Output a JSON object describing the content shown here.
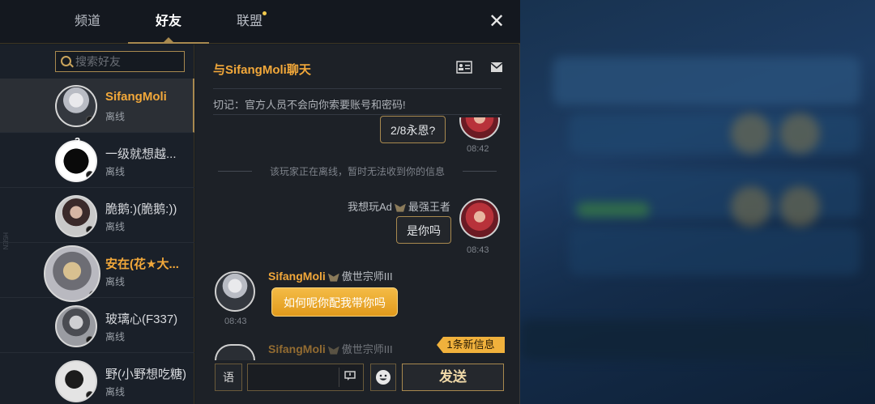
{
  "tabs": [
    {
      "label": "频道"
    },
    {
      "label": "好友"
    },
    {
      "label": "联盟"
    }
  ],
  "search": {
    "placeholder": "搜索好友"
  },
  "friends": [
    {
      "name": "SifangMoli",
      "status": "离线"
    },
    {
      "name": "一级就想越...",
      "status": "离线",
      "badge": "3"
    },
    {
      "name": "脆鹅:)(脆鹅:))",
      "status": "离线"
    },
    {
      "name": "安在(花★大...",
      "status": "离线"
    },
    {
      "name": "玻璃心(F337)",
      "status": "离线"
    },
    {
      "name": "野(小野想吃糖)",
      "status": "离线"
    }
  ],
  "side_text": "H5EN",
  "chat": {
    "title": "与SifangMoli聊天",
    "warning": "切记：官方人员不会向你索要账号和密码!",
    "messages": [
      {
        "text": "2/8永恩?",
        "time": "08:42"
      },
      {
        "system": "该玩家正在离线，暂时无法收到你的信息"
      },
      {
        "sender_title": "我想玩Ad",
        "sender_rank": "最强王者",
        "text": "是你吗",
        "time": "08:43"
      },
      {
        "sender_name": "SifangMoli",
        "sender_rank": "傲世宗师III",
        "text": "如何呢你配我带你吗",
        "time": "08:43"
      },
      {
        "sender_name": "SifangMoli",
        "sender_rank": "傲世宗师III"
      }
    ],
    "new_message_badge": "1条新信息",
    "send_label": "发送",
    "voice_label": "语"
  },
  "colors": {
    "accent_gold": "#f2a83a",
    "border_gold": "#a8894f",
    "bubble_orange": "#e19a1c"
  }
}
